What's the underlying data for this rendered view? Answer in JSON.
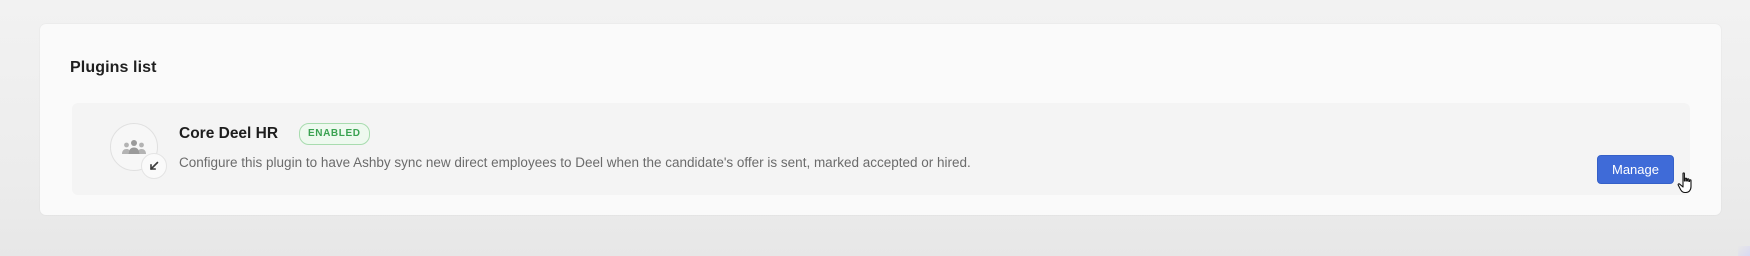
{
  "panel": {
    "title": "Plugins list"
  },
  "plugins": [
    {
      "name": "Core Deel HR",
      "status": "ENABLED",
      "description": "Configure this plugin to have Ashby sync new direct employees to Deel when the candidate's offer is sent, marked accepted or hired.",
      "icon": "people-group-icon",
      "sub_icon": "arrow-down-left-icon",
      "manage_label": "Manage"
    }
  ],
  "colors": {
    "status_green": "#3aa251",
    "status_green_bg": "#eef9ef",
    "manage_button_blue": "#3f6bd8"
  }
}
